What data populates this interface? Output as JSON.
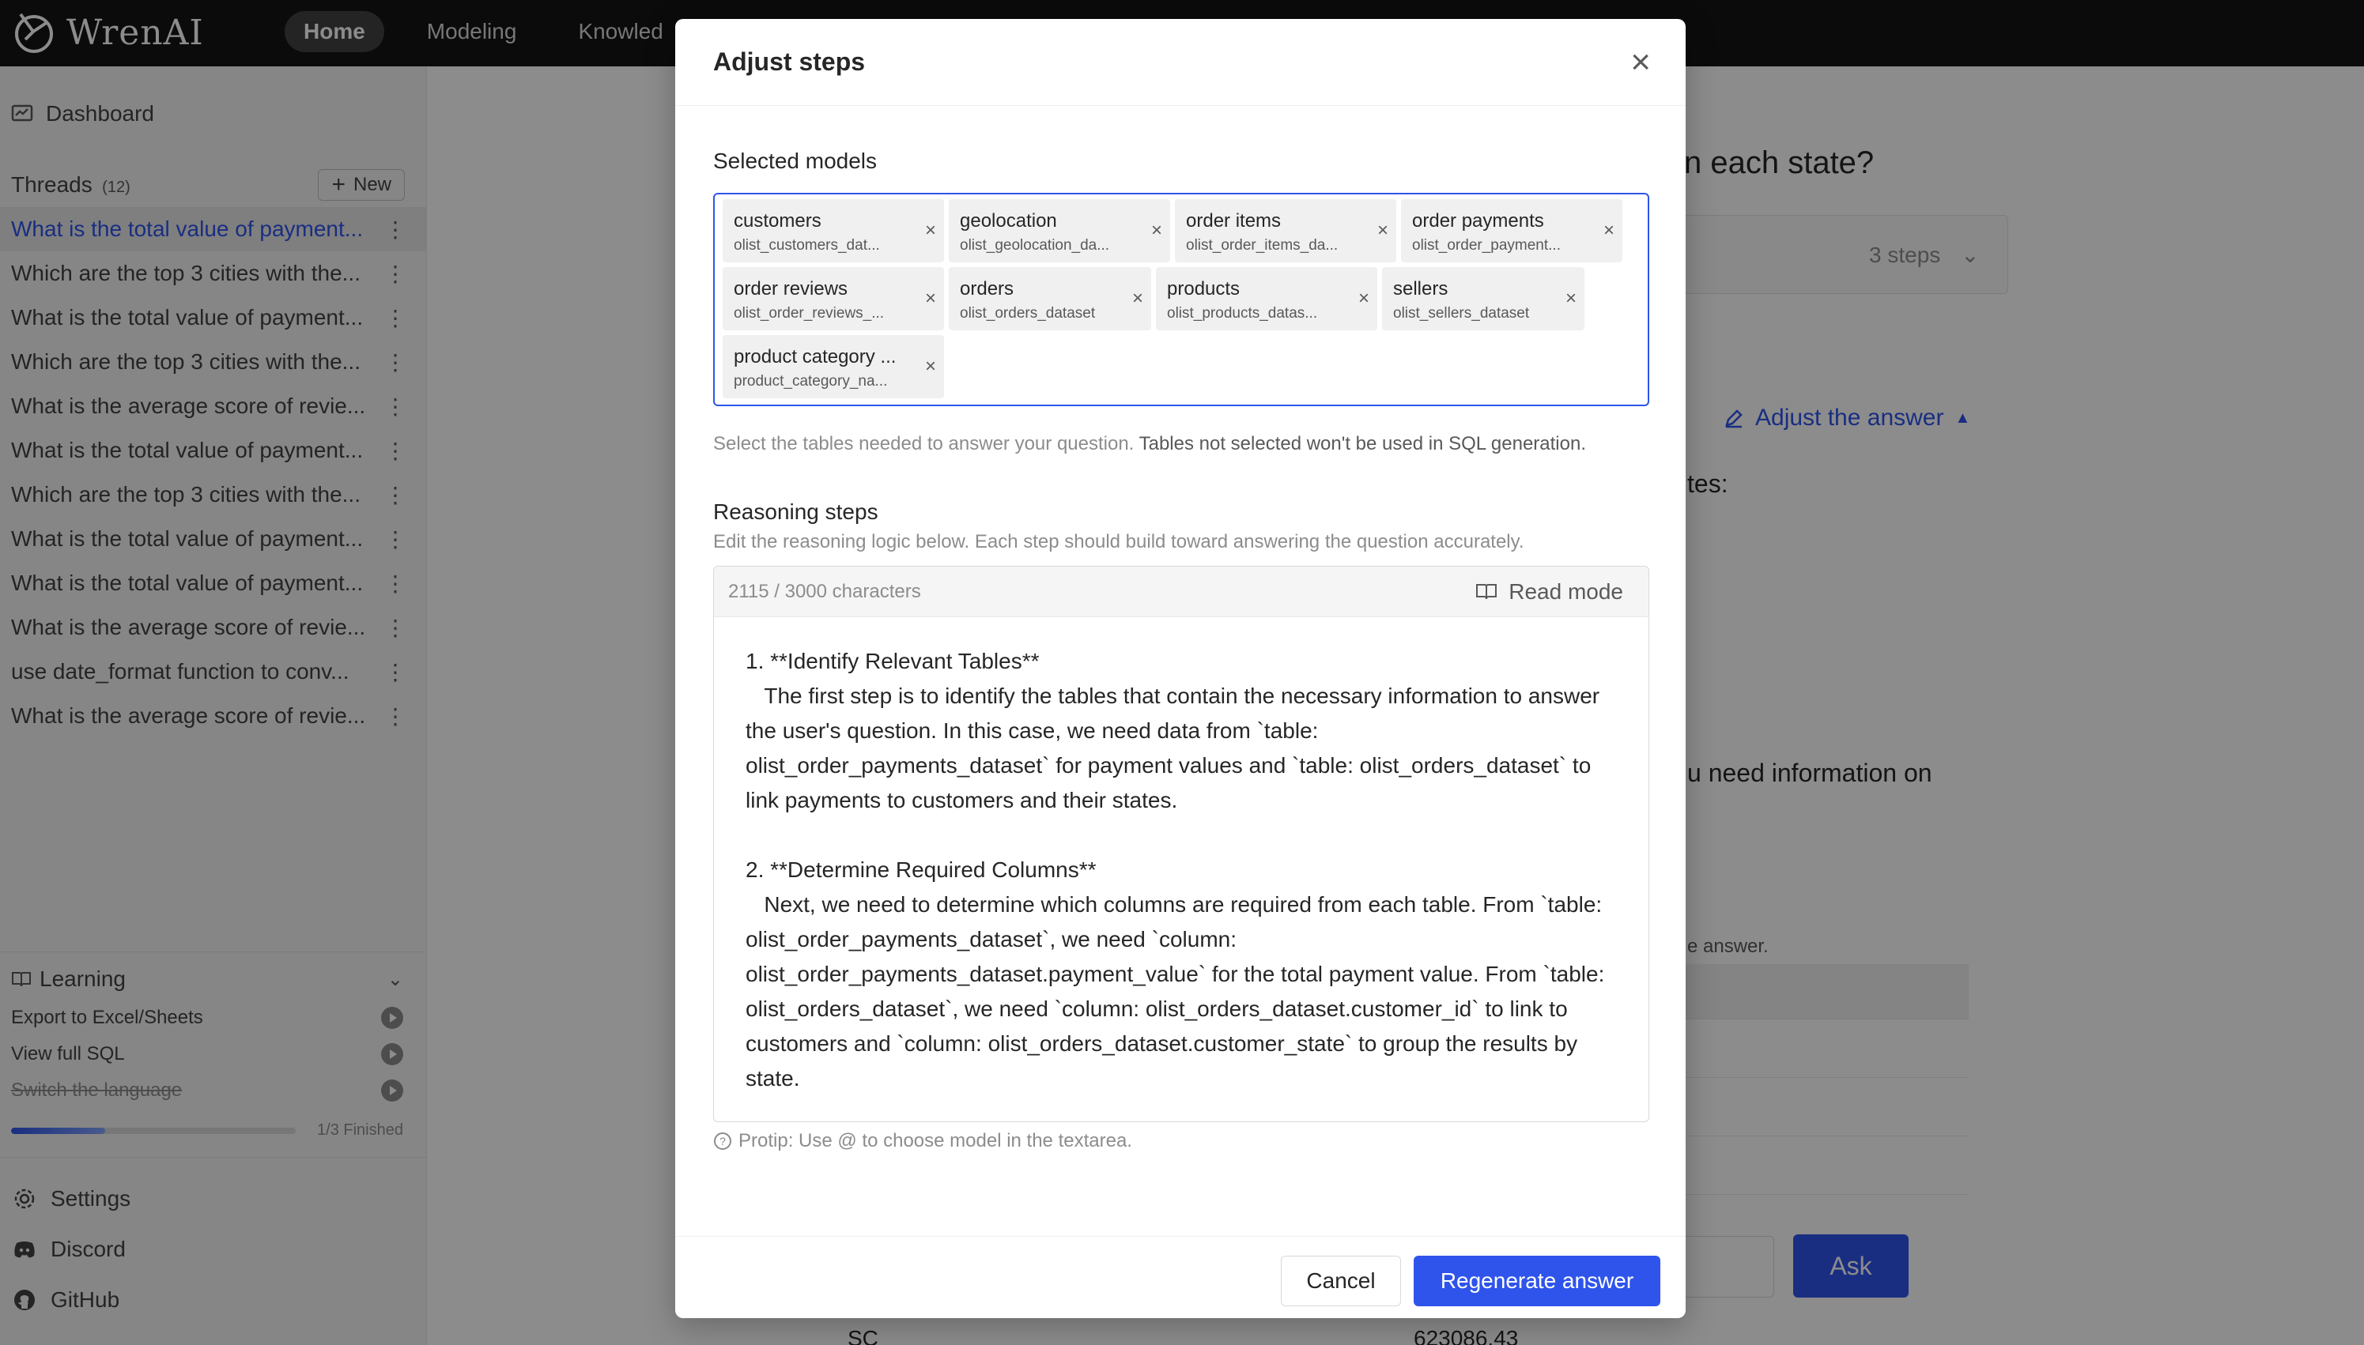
{
  "app": {
    "logo": "WrenAI"
  },
  "nav": {
    "tabs": [
      {
        "label": "Home"
      },
      {
        "label": "Modeling"
      },
      {
        "label": "Knowled"
      }
    ]
  },
  "sidebar": {
    "dashboard": "Dashboard",
    "threads_label": "Threads",
    "threads_count": "(12)",
    "new_label": "New",
    "threads": [
      "What is the total value of payment...",
      "Which are the top 3 cities with the...",
      "What is the total value of payment...",
      "Which are the top 3 cities with the...",
      "What is the average score of revie...",
      "What is the total value of payment...",
      "Which are the top 3 cities with the...",
      "What is the total value of payment...",
      "What is the total value of payment...",
      "What is the average score of revie...",
      "use date_format function to conv...",
      "What is the average score of revie..."
    ],
    "learning": {
      "label": "Learning",
      "items": [
        "Export to Excel/Sheets",
        "View full SQL",
        "Switch the language"
      ],
      "progress": 0.33,
      "progress_text": "1/3 Finished"
    },
    "links": [
      "Settings",
      "Discord",
      "GitHub"
    ]
  },
  "background": {
    "question_fragment": "n each state?",
    "steps_label": "3 steps",
    "adjust_answer": "Adjust the answer",
    "answer_fragment1": "tes:",
    "answer_fragment2": "u need information on",
    "answer_fragment3": "e answer.",
    "ask_label": "Ask",
    "row_state": "SC",
    "row_value": "623086.43"
  },
  "modal": {
    "title": "Adjust steps",
    "selected_models_label": "Selected models",
    "models": [
      {
        "name": "customers",
        "table": "olist_customers_dat..."
      },
      {
        "name": "geolocation",
        "table": "olist_geolocation_da..."
      },
      {
        "name": "order items",
        "table": "olist_order_items_da..."
      },
      {
        "name": "order payments",
        "table": "olist_order_payment..."
      },
      {
        "name": "order reviews",
        "table": "olist_order_reviews_..."
      },
      {
        "name": "orders",
        "table": "olist_orders_dataset"
      },
      {
        "name": "products",
        "table": "olist_products_datas..."
      },
      {
        "name": "sellers",
        "table": "olist_sellers_dataset"
      },
      {
        "name": "product category ...",
        "table": "product_category_na..."
      }
    ],
    "models_help_prefix": "Select the tables needed to answer your question.",
    "models_help_strong": "Tables not selected won't be used in SQL generation.",
    "reasoning_label": "Reasoning steps",
    "reasoning_help": "Edit the reasoning logic below. Each step should build toward answering the question accurately.",
    "char_count": "2115 / 3000 characters",
    "read_mode": "Read mode",
    "reasoning_text": "1. **Identify Relevant Tables**\n   The first step is to identify the tables that contain the necessary information to answer the user's question. In this case, we need data from `table: olist_order_payments_dataset` for payment values and `table: olist_orders_dataset` to link payments to customers and their states.\n\n2. **Determine Required Columns**\n   Next, we need to determine which columns are required from each table. From `table: olist_order_payments_dataset`, we need `column: olist_order_payments_dataset.payment_value` for the total payment value. From `table: olist_orders_dataset`, we need `column: olist_orders_dataset.customer_id` to link to customers and `column: olist_orders_dataset.customer_state` to group the results by state.",
    "protip": "Protip: Use @ to choose model in the textarea.",
    "cancel": "Cancel",
    "regenerate": "Regenerate answer"
  },
  "colors": {
    "accent": "#2f54eb",
    "nav_bg": "#141414",
    "sidebar_bg": "#f5f5f5"
  }
}
